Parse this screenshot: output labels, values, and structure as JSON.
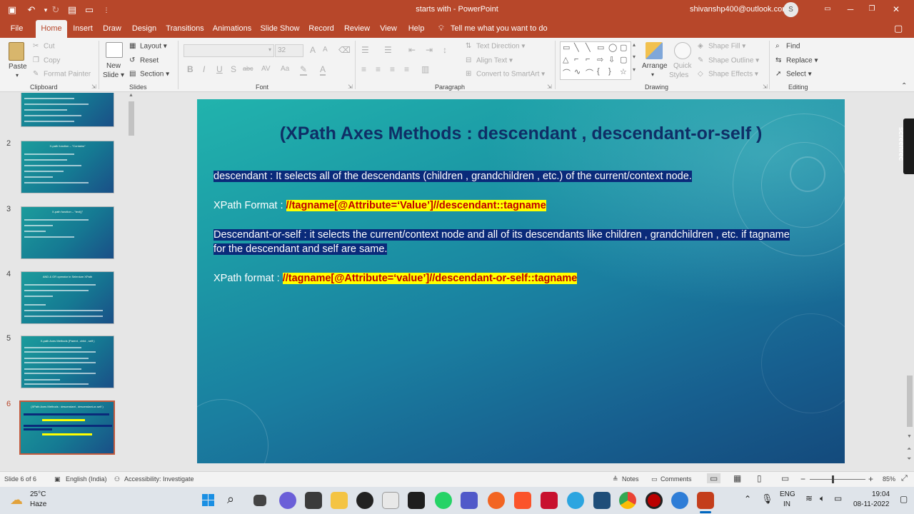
{
  "title_bar": {
    "doc_name": "starts with",
    "sep": " - ",
    "app": "PowerPoint",
    "account": "shivanshp400@outlook.com",
    "avatar": "S",
    "qa_icons": [
      "save-icon",
      "undo-icon",
      "redo-icon",
      "present-icon",
      "fit-icon",
      "more-icon"
    ]
  },
  "tabs": [
    "File",
    "Home",
    "Insert",
    "Draw",
    "Design",
    "Transitions",
    "Animations",
    "Slide Show",
    "Record",
    "Review",
    "View",
    "Help"
  ],
  "active_tab": "Home",
  "tell_me": "Tell me what you want to do",
  "ribbon": {
    "clipboard": {
      "paste": "Paste",
      "cut": "Cut",
      "copy": "Copy",
      "format_painter": "Format Painter",
      "label": "Clipboard"
    },
    "slides": {
      "new_slide": "New",
      "new_slide2": "Slide",
      "layout": "Layout",
      "reset": "Reset",
      "section": "Section",
      "label": "Slides"
    },
    "font": {
      "size": "32",
      "label": "Font",
      "buttons": [
        "B",
        "I",
        "U",
        "S",
        "abc",
        "AV",
        "Aa"
      ]
    },
    "paragraph": {
      "text_direction": "Text Direction",
      "align_text": "Align Text",
      "convert_smartart": "Convert to SmartArt",
      "label": "Paragraph"
    },
    "drawing": {
      "arrange": "Arrange",
      "quick": "Quick",
      "styles": "Styles",
      "shape_fill": "Shape Fill",
      "shape_outline": "Shape Outline",
      "shape_effects": "Shape Effects",
      "label": "Drawing"
    },
    "editing": {
      "find": "Find",
      "replace": "Replace",
      "select": "Select",
      "label": "Editing"
    }
  },
  "thumbnails": [
    {
      "num": "",
      "title": "",
      "lines": 4
    },
    {
      "num": "2",
      "title": "X-path function – \"Contains\"",
      "lines": 6
    },
    {
      "num": "3",
      "title": "X-path function – \"text()\"",
      "lines": 4
    },
    {
      "num": "4",
      "title": "AND & OR operator in Selenium XPath",
      "lines": 6
    },
    {
      "num": "5",
      "title": "X-path Axes Methods (Parent , child , self )",
      "lines": 8
    },
    {
      "num": "6",
      "title": "(XPath Axes Methods : descendant , descendant-or-self )",
      "lines": 6
    }
  ],
  "slide": {
    "title": "(XPath Axes Methods : descendant , descendant-or-self )",
    "line1": "descendant : It selects all of the descendants (children , grandchildren , etc.)  of the current/context node.",
    "line2_label": "XPath Format : ",
    "line2_code": "//tagname[@Attribute=‘Value’]//descendant::tagname",
    "line3a": "Descendant-or-self : it selects the current/context node and all of its descendants like children , grandchildren , etc. if tagname",
    "line3b": "for the descendant and self are same.",
    "line4_label": "XPath format : ",
    "line4_code": "//tagname[@Attribute=‘value’]//descendant-or-self::tagname"
  },
  "recorder": "screenrec",
  "status": {
    "slide": "Slide 6 of 6",
    "language": "English (India)",
    "accessibility": "Accessibility: Investigate",
    "notes": "Notes",
    "comments": "Comments",
    "zoom": "85%"
  },
  "taskbar": {
    "temp": "25°C",
    "weather": "Haze",
    "lang1": "ENG",
    "lang2": "IN",
    "time": "19:04",
    "date": "08-11-2022"
  },
  "colors": {
    "accent": "#b7472a",
    "selection": "#0a2a7a",
    "highlight": "#ffff00",
    "code_text": "#c00000",
    "title_text": "#0f2e66"
  }
}
